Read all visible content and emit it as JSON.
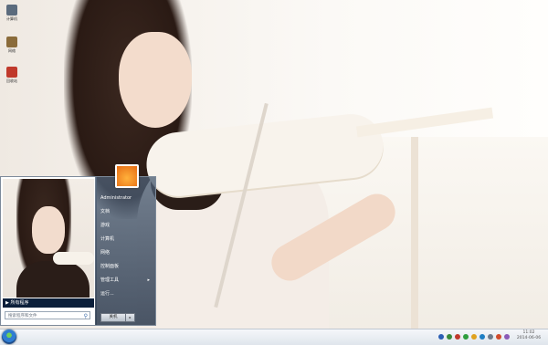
{
  "desktop_icons": [
    {
      "name": "computer",
      "label": "计算机",
      "color": "#5b6b7d"
    },
    {
      "name": "network",
      "label": "网络",
      "color": "#8a6b3a"
    },
    {
      "name": "recycle-bin",
      "label": "回收站",
      "color": "#c0392b"
    }
  ],
  "start_menu": {
    "all_programs_label": "所有程序",
    "search_placeholder": "搜索程序和文件",
    "user_name": "Administrator",
    "items": [
      {
        "label": "Administrator",
        "has_submenu": false
      },
      {
        "label": "文档",
        "has_submenu": false
      },
      {
        "label": "游戏",
        "has_submenu": false
      },
      {
        "label": "计算机",
        "has_submenu": false
      },
      {
        "label": "网络",
        "has_submenu": false
      },
      {
        "label": "控制面板",
        "has_submenu": false
      },
      {
        "label": "管理工具",
        "has_submenu": true
      },
      {
        "label": "运行...",
        "has_submenu": false
      }
    ],
    "shutdown_label": "关机"
  },
  "taskbar": {
    "clock_time": "11:02",
    "clock_date": "2014-06-06",
    "tray_icons": [
      {
        "name": "help-icon",
        "color": "#2b5fb4"
      },
      {
        "name": "network-icon",
        "color": "#3a8a3a"
      },
      {
        "name": "security-icon",
        "color": "#c0392b"
      },
      {
        "name": "update-icon",
        "color": "#2e9e3e"
      },
      {
        "name": "qq-icon",
        "color": "#e0a21f"
      },
      {
        "name": "antivirus-icon",
        "color": "#1f7fc4"
      },
      {
        "name": "volume-icon",
        "color": "#6f7c8b"
      },
      {
        "name": "flag-icon",
        "color": "#d14b2b"
      },
      {
        "name": "notify-icon",
        "color": "#8a5bb8"
      }
    ]
  }
}
